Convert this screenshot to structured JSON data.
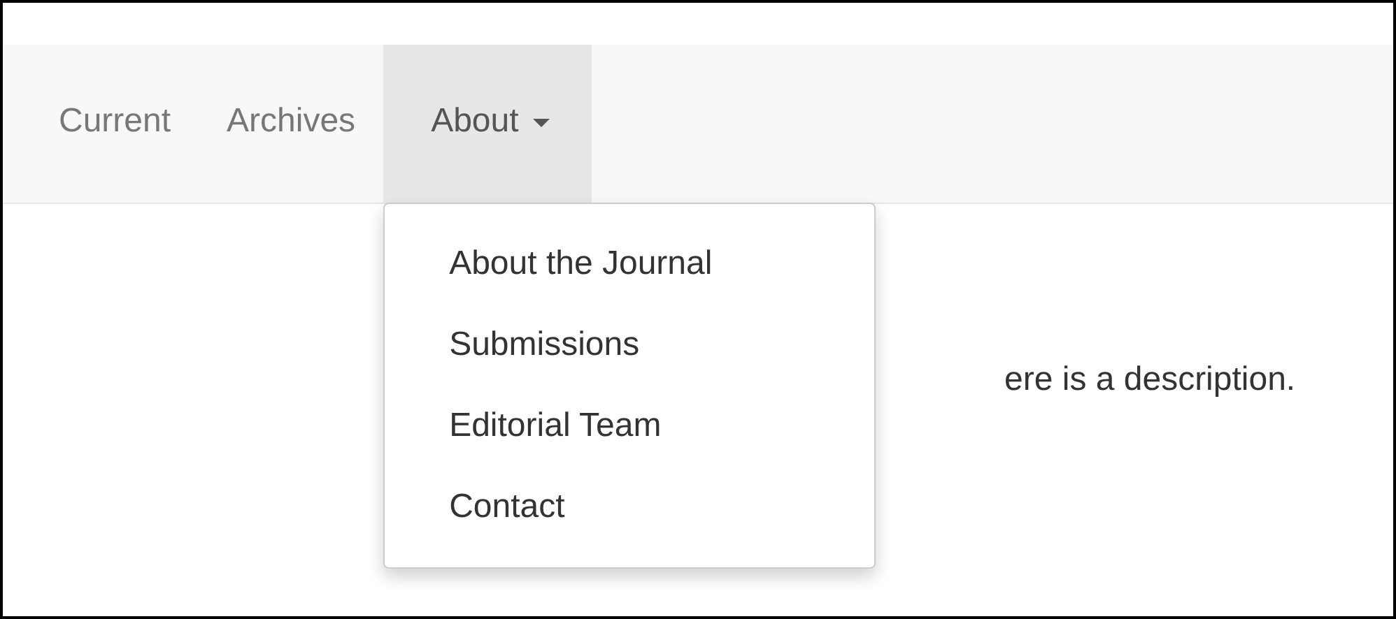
{
  "nav": {
    "items": [
      {
        "label": "Current",
        "selected": false,
        "has_menu": false
      },
      {
        "label": "Archives",
        "selected": false,
        "has_menu": false
      },
      {
        "label": "About",
        "selected": true,
        "has_menu": true
      }
    ]
  },
  "dropdown": {
    "expanded": true,
    "items": [
      {
        "label": "About the Journal"
      },
      {
        "label": "Submissions"
      },
      {
        "label": "Editorial Team"
      },
      {
        "label": "Contact"
      }
    ]
  },
  "content": {
    "text": "ere is a description."
  }
}
